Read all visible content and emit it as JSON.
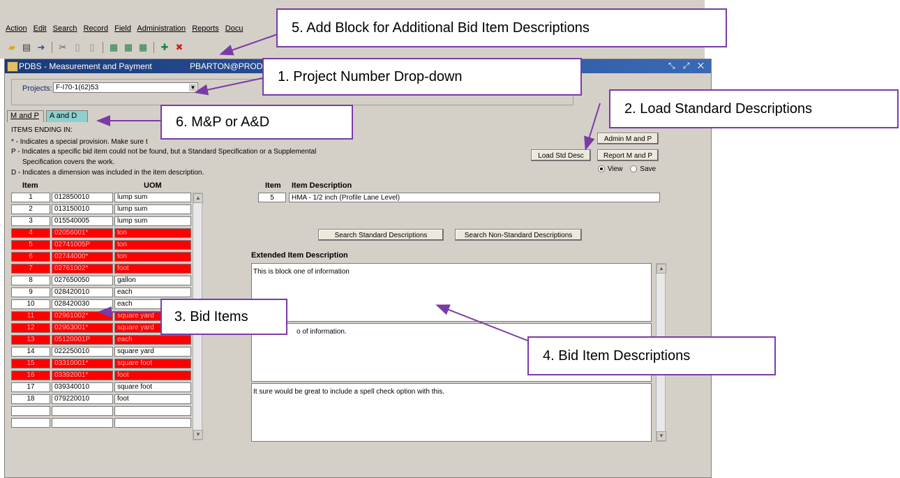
{
  "menu": [
    "Action",
    "Edit",
    "Search",
    "Record",
    "Field",
    "Administration",
    "Reports",
    "Docu"
  ],
  "toolbar_icons": [
    "open-folder-icon",
    "print-icon",
    "exit-icon",
    "cut-icon",
    "copy-icon",
    "paste-icon",
    "query-icon",
    "query-execute-icon",
    "query-count-icon",
    "insert-record-icon",
    "delete-record-icon"
  ],
  "window": {
    "title": "PDBS - Measurement and Payment",
    "user": "PBARTON@PROD",
    "controls": "✕"
  },
  "project": {
    "label": "Projects:",
    "value": "F-I70-1(62)53"
  },
  "tabs": [
    "M and P",
    "A and D"
  ],
  "legend": {
    "heading": "ITEMS ENDING IN:",
    "star": "* - Indicates a special provision.  Make sure t",
    "p1": "P - Indicates a specific bid item could not be found, but a Standard Specification or a Supplemental",
    "p2": "Specification covers the work.",
    "d": "D - Indicates a dimension was included in the item description."
  },
  "buttons": {
    "admin": "Admin M and P",
    "load_std": "Load Std Desc",
    "report": "Report M and P",
    "search_std": "Search Standard Descriptions",
    "search_nonstd": "Search Non-Standard Descriptions"
  },
  "radio": {
    "view": "View",
    "save": "Save",
    "selected": "view"
  },
  "table": {
    "headers": [
      "Item",
      "UOM"
    ],
    "rows": [
      {
        "n": "1",
        "code": "012850010",
        "uom": "lump sum",
        "red": false
      },
      {
        "n": "2",
        "code": "013150010",
        "uom": "lump sum",
        "red": false
      },
      {
        "n": "3",
        "code": "015540005",
        "uom": "lump sum",
        "red": false
      },
      {
        "n": "4",
        "code": "02056001*",
        "uom": "ton",
        "red": true
      },
      {
        "n": "5",
        "code": "02741005P",
        "uom": "ton",
        "red": true
      },
      {
        "n": "6",
        "code": "02744000*",
        "uom": "ton",
        "red": true
      },
      {
        "n": "7",
        "code": "02761002*",
        "uom": "foot",
        "red": true
      },
      {
        "n": "8",
        "code": "027650050",
        "uom": "gallon",
        "red": false
      },
      {
        "n": "9",
        "code": "028420010",
        "uom": "each",
        "red": false
      },
      {
        "n": "10",
        "code": "028420030",
        "uom": "each",
        "red": false
      },
      {
        "n": "11",
        "code": "02961002*",
        "uom": "square yard",
        "red": true
      },
      {
        "n": "12",
        "code": "02963001*",
        "uom": "square yard",
        "red": true
      },
      {
        "n": "13",
        "code": "05120001P",
        "uom": "each",
        "red": true
      },
      {
        "n": "14",
        "code": "022250010",
        "uom": "square yard",
        "red": false
      },
      {
        "n": "15",
        "code": "03310001*",
        "uom": "square foot",
        "red": true
      },
      {
        "n": "16",
        "code": "03392001*",
        "uom": "foot",
        "red": true
      },
      {
        "n": "17",
        "code": "039340010",
        "uom": "square foot",
        "red": false
      },
      {
        "n": "18",
        "code": "079220010",
        "uom": "foot",
        "red": false
      },
      {
        "n": "",
        "code": "",
        "uom": "",
        "red": false
      },
      {
        "n": "",
        "code": "",
        "uom": "",
        "red": false
      }
    ]
  },
  "detail": {
    "item_label": "Item",
    "desc_label": "Item Description",
    "item_value": "5",
    "desc_value": "HMA - 1/2 inch (Profile Lane Level)",
    "ext_label": "Extended Item Description",
    "block1": "This is block one of information",
    "block2": "o of information.",
    "block3": "It sure would be great to include a spell check option with this."
  },
  "callouts": {
    "c1": "1.     Project Number Drop-down",
    "c2": "2.  Load Standard Descriptions",
    "c3": "3.  Bid Items",
    "c4": "4.  Bid Item Descriptions",
    "c5": "5.  Add Block for Additional Bid Item Descriptions",
    "c6": "6.  M&P or A&D"
  },
  "colors": {
    "annotation": "#7a3aa8",
    "missing_item": "#ff0000",
    "tab_active": "#8ecfd0"
  }
}
